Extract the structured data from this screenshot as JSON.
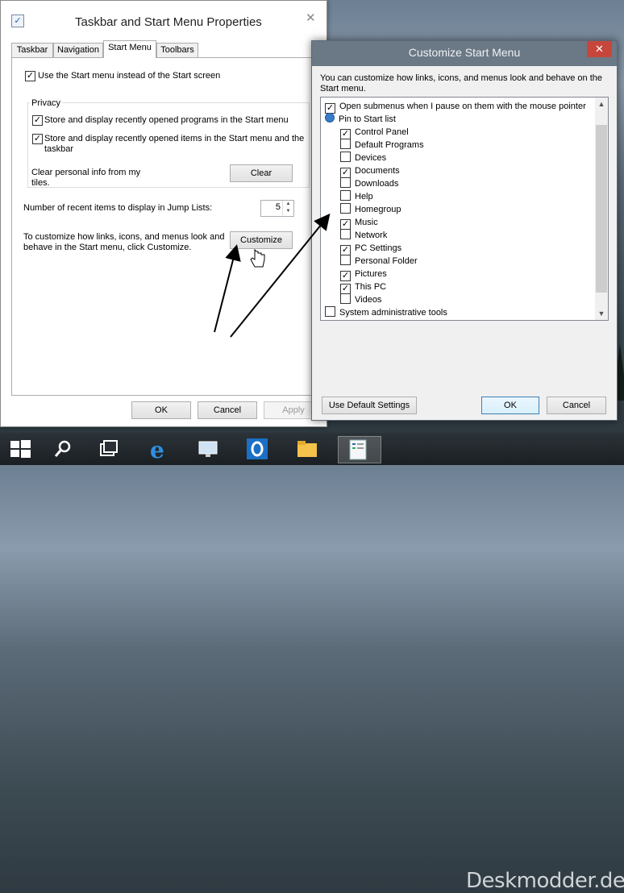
{
  "props": {
    "title": "Taskbar and Start Menu Properties",
    "close": "✕",
    "tabs": [
      "Taskbar",
      "Navigation",
      "Start Menu",
      "Toolbars"
    ],
    "use_start_menu": "Use the Start menu instead of the Start screen",
    "privacy_title": "Privacy",
    "store_programs": "Store and display recently opened programs in the Start menu",
    "store_items": "Store and display recently opened items in the Start menu and the taskbar",
    "clear_info": "Clear personal info from my tiles.",
    "clear_button": "Clear",
    "jump_label": "Number of recent items to display in Jump Lists:",
    "jump_value": "5",
    "customize_text": "To customize how links, icons, and menus look and behave in the Start menu, click Customize.",
    "customize_button": "Customize",
    "ok": "OK",
    "cancel": "Cancel",
    "apply": "Apply"
  },
  "customize": {
    "title": "Customize Start Menu",
    "close": "✕",
    "description": "You can customize how links, icons, and menus look and behave on the Start menu.",
    "items": [
      {
        "label": "Open submenus when I pause on them with the mouse pointer",
        "checked": true
      },
      {
        "label": "Pin to Start list",
        "header": true
      },
      {
        "label": "Control Panel",
        "checked": true
      },
      {
        "label": "Default Programs",
        "checked": false
      },
      {
        "label": "Devices",
        "checked": false
      },
      {
        "label": "Documents",
        "checked": true
      },
      {
        "label": "Downloads",
        "checked": false
      },
      {
        "label": "Help",
        "checked": false
      },
      {
        "label": "Homegroup",
        "checked": false
      },
      {
        "label": "Music",
        "checked": true
      },
      {
        "label": "Network",
        "checked": false
      },
      {
        "label": "PC Settings",
        "checked": true
      },
      {
        "label": "Personal Folder",
        "checked": false
      },
      {
        "label": "Pictures",
        "checked": true
      },
      {
        "label": "This PC",
        "checked": true
      },
      {
        "label": "Videos",
        "checked": false
      },
      {
        "label": "System administrative tools",
        "checked": false
      }
    ],
    "use_default": "Use Default Settings",
    "ok": "OK",
    "cancel": "Cancel"
  },
  "taskbar": {
    "watermark": "Deskmodder.de",
    "icons": [
      "windows-start-icon",
      "search-icon",
      "task-view-icon",
      "internet-explorer-icon",
      "remote-desktop-icon",
      "outlook-icon",
      "file-explorer-icon",
      "control-panel-icon"
    ]
  },
  "colors": {
    "accent": "#3c7fb1",
    "close_red": "#c7463b",
    "dialog_title": "#6b7885"
  }
}
